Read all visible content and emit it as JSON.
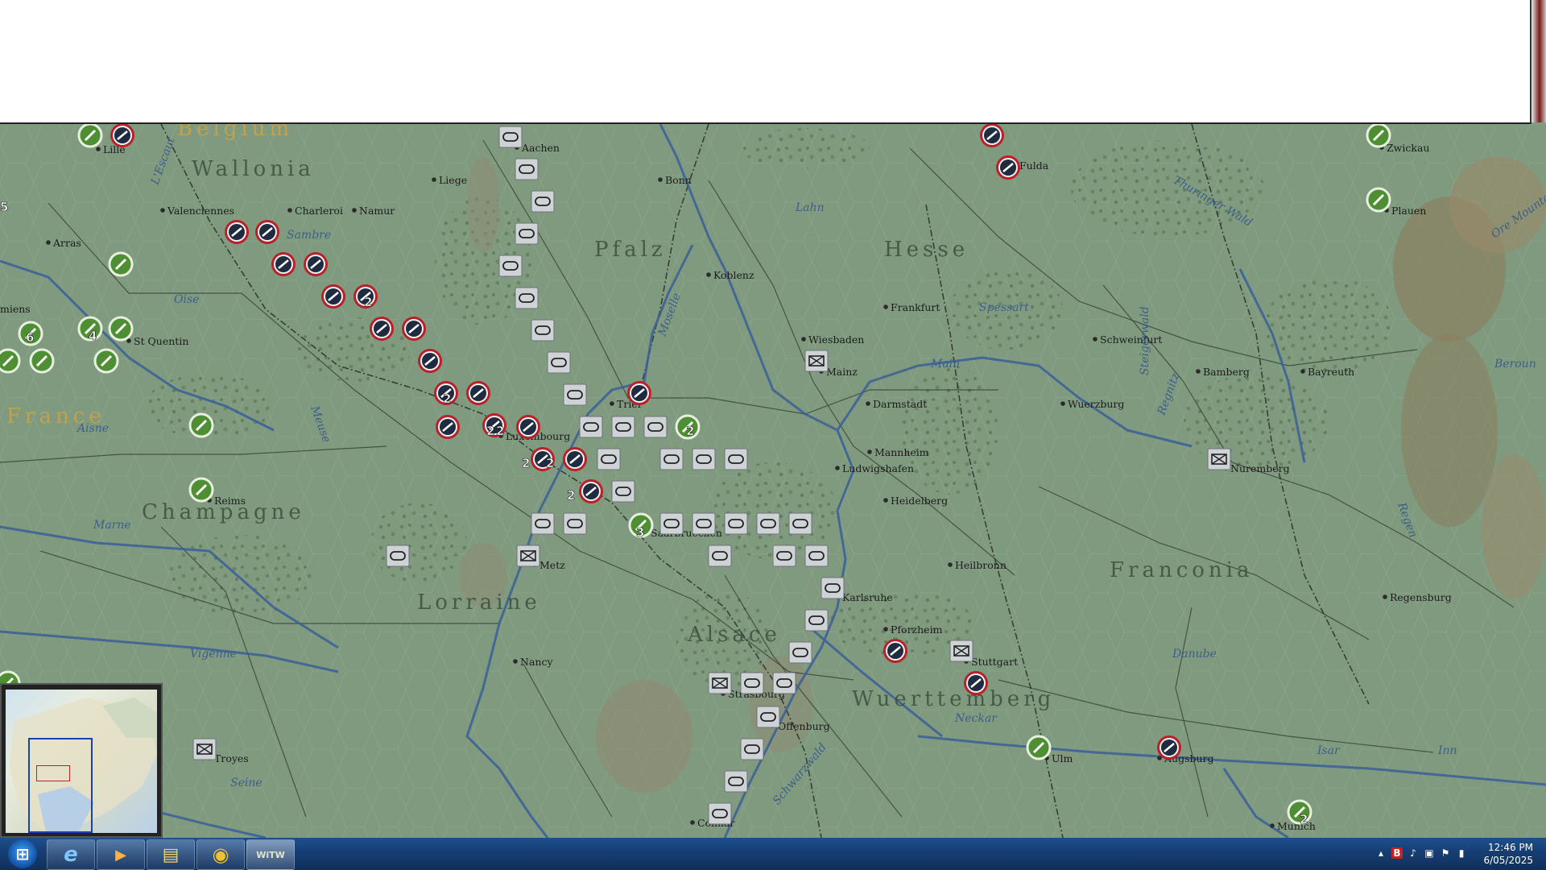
{
  "map": {
    "regions": [
      {
        "id": "wallonia",
        "label": "Wallonia"
      },
      {
        "id": "belgium",
        "label": "Belgium"
      },
      {
        "id": "pfalz",
        "label": "Pfalz"
      },
      {
        "id": "hesse",
        "label": "Hesse"
      },
      {
        "id": "france",
        "label": "France"
      },
      {
        "id": "champagne",
        "label": "Champagne"
      },
      {
        "id": "lorraine",
        "label": "Lorraine"
      },
      {
        "id": "alsace",
        "label": "Alsace"
      },
      {
        "id": "franconia",
        "label": "Franconia"
      },
      {
        "id": "wuerttemberg",
        "label": "Wuerttemberg"
      }
    ],
    "cities": [
      {
        "id": "lille",
        "label": "Lille"
      },
      {
        "id": "aachen",
        "label": "Aachen"
      },
      {
        "id": "bonn",
        "label": "Bonn"
      },
      {
        "id": "zwickau",
        "label": "Zwickau"
      },
      {
        "id": "liege",
        "label": "Liege"
      },
      {
        "id": "valenciennes",
        "label": "Valenciennes"
      },
      {
        "id": "charleroi",
        "label": "Charleroi"
      },
      {
        "id": "namur",
        "label": "Namur"
      },
      {
        "id": "plauen",
        "label": "Plauen"
      },
      {
        "id": "arras",
        "label": "Arras"
      },
      {
        "id": "koblenz",
        "label": "Koblenz"
      },
      {
        "id": "frankfurt",
        "label": "Frankfurt"
      },
      {
        "id": "amiens",
        "label": "miens"
      },
      {
        "id": "st-quentin",
        "label": "St Quentin"
      },
      {
        "id": "wiesbaden",
        "label": "Wiesbaden"
      },
      {
        "id": "mainz",
        "label": "Mainz"
      },
      {
        "id": "schweinfurt",
        "label": "Schweinfurt"
      },
      {
        "id": "bamberg",
        "label": "Bamberg"
      },
      {
        "id": "bayreuth",
        "label": "Bayreuth"
      },
      {
        "id": "trier",
        "label": "Trier"
      },
      {
        "id": "darmstadt",
        "label": "Darmstadt"
      },
      {
        "id": "wuerzburg",
        "label": "Wuerzburg"
      },
      {
        "id": "luxembourg",
        "label": "Luxembourg"
      },
      {
        "id": "mannheim",
        "label": "Mannheim"
      },
      {
        "id": "ludwigshafen",
        "label": "Ludwigshafen"
      },
      {
        "id": "nuremberg",
        "label": "Nuremberg"
      },
      {
        "id": "reims",
        "label": "Reims"
      },
      {
        "id": "heidelberg",
        "label": "Heidelberg"
      },
      {
        "id": "saarbruecken",
        "label": "Saarbruecken"
      },
      {
        "id": "metz",
        "label": "Metz"
      },
      {
        "id": "heilbronn",
        "label": "Heilbronn"
      },
      {
        "id": "karlsruhe",
        "label": "Karlsruhe"
      },
      {
        "id": "regensburg",
        "label": "Regensburg"
      },
      {
        "id": "pforzheim",
        "label": "Pforzheim"
      },
      {
        "id": "nancy",
        "label": "Nancy"
      },
      {
        "id": "stuttgart",
        "label": "Stuttgart"
      },
      {
        "id": "strasbourg",
        "label": "Strasbourg"
      },
      {
        "id": "offenburg",
        "label": "Offenburg"
      },
      {
        "id": "troyes",
        "label": "Troyes"
      },
      {
        "id": "ulm",
        "label": "Ulm"
      },
      {
        "id": "augsburg",
        "label": "Augsburg"
      },
      {
        "id": "colmar",
        "label": "Colmar"
      },
      {
        "id": "munich",
        "label": "Munich"
      },
      {
        "id": "fulda",
        "label": "Fulda"
      }
    ],
    "rivers": [
      {
        "id": "lescaut",
        "label": "L'Escaut"
      },
      {
        "id": "sambre",
        "label": "Sambre"
      },
      {
        "id": "lahn",
        "label": "Lahn"
      },
      {
        "id": "oise",
        "label": "Oise"
      },
      {
        "id": "moselle",
        "label": "Moselle"
      },
      {
        "id": "main",
        "label": "Main"
      },
      {
        "id": "meuse",
        "label": "Meuse"
      },
      {
        "id": "aisne",
        "label": "Aisne"
      },
      {
        "id": "marne",
        "label": "Marne"
      },
      {
        "id": "vigenne",
        "label": "Vigenne"
      },
      {
        "id": "danube",
        "label": "Danube"
      },
      {
        "id": "neckar",
        "label": "Neckar"
      },
      {
        "id": "seine",
        "label": "Seine"
      },
      {
        "id": "isar",
        "label": "Isar"
      },
      {
        "id": "inn",
        "label": "Inn"
      },
      {
        "id": "beroun",
        "label": "Beroun"
      },
      {
        "id": "regnitz",
        "label": "Regnitz"
      },
      {
        "id": "regen",
        "label": "Regen"
      },
      {
        "id": "spessart",
        "label": "Spessart"
      },
      {
        "id": "steigerwald",
        "label": "Steigerwald"
      },
      {
        "id": "schwarzwald",
        "label": "Schwarzwald"
      },
      {
        "id": "thuringerwald",
        "label": "Thuringer Wald"
      },
      {
        "id": "oremountains",
        "label": "Ore Mountains"
      }
    ],
    "stack_counts": [
      "2",
      "2",
      "2",
      "2",
      "2",
      "2",
      "2",
      "2",
      "3",
      "4",
      "6",
      "2",
      "5"
    ],
    "colors": {
      "terrain": "#7f9a7e",
      "hex_line": "#8fa98e",
      "river": "#3a5f99",
      "border": "#2a2a2a",
      "axis_marker": "#1e2b40",
      "allied_marker": "#3c7a2a"
    }
  },
  "minimap": {
    "label": "minimap"
  },
  "taskbar": {
    "apps": [
      {
        "id": "start",
        "icon": "windows-start-icon"
      },
      {
        "id": "ie",
        "icon": "internet-explorer-icon",
        "glyph": "e"
      },
      {
        "id": "media",
        "icon": "media-player-icon",
        "glyph": "▶"
      },
      {
        "id": "explorer",
        "icon": "file-explorer-icon",
        "glyph": "▤"
      },
      {
        "id": "chrome",
        "icon": "chrome-icon",
        "glyph": "◉"
      },
      {
        "id": "witw",
        "icon": "witw-game-icon",
        "glyph": "WiTW"
      }
    ],
    "clock": {
      "time": "12:46 PM",
      "date": "6/05/2025"
    },
    "tray": [
      "show-hidden-icon",
      "b-icon",
      "volume-icon",
      "network-icon",
      "flag-icon",
      "signal-icon"
    ]
  }
}
